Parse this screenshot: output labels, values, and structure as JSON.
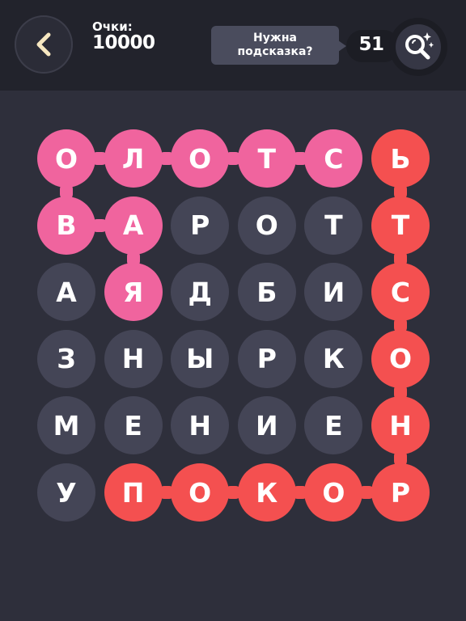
{
  "header": {
    "back_icon": "chevron-left-icon",
    "score_label": "Очки:",
    "score_value": "10000",
    "hint_prompt_line1": "Нужна",
    "hint_prompt_line2": "подсказка?",
    "hint_count": "51",
    "hint_icon": "magnifier-sparkle-icon"
  },
  "colors": {
    "background": "#2e2f3b",
    "topbar": "#22232c",
    "cell_default": "#444556",
    "word_pink": "#f0649e",
    "word_red": "#f45050"
  },
  "grid": {
    "rows": [
      [
        "О",
        "Л",
        "О",
        "Т",
        "С",
        "Ь"
      ],
      [
        "В",
        "А",
        "Р",
        "О",
        "Т",
        "Т"
      ],
      [
        "А",
        "Я",
        "Д",
        "Б",
        "И",
        "С"
      ],
      [
        "З",
        "Н",
        "Ы",
        "Р",
        "К",
        "О"
      ],
      [
        "М",
        "Е",
        "Н",
        "И",
        "Е",
        "Н"
      ],
      [
        "У",
        "П",
        "О",
        "К",
        "О",
        "Р"
      ]
    ],
    "highlight": [
      [
        "pink",
        "pink",
        "pink",
        "pink",
        "pink",
        "red"
      ],
      [
        "pink",
        "pink",
        "",
        "",
        "",
        "red"
      ],
      [
        "",
        "pink",
        "",
        "",
        "",
        "red"
      ],
      [
        "",
        "",
        "",
        "",
        "",
        "red"
      ],
      [
        "",
        "",
        "",
        "",
        "",
        "red"
      ],
      [
        "",
        "red",
        "red",
        "red",
        "red",
        "red"
      ]
    ]
  }
}
